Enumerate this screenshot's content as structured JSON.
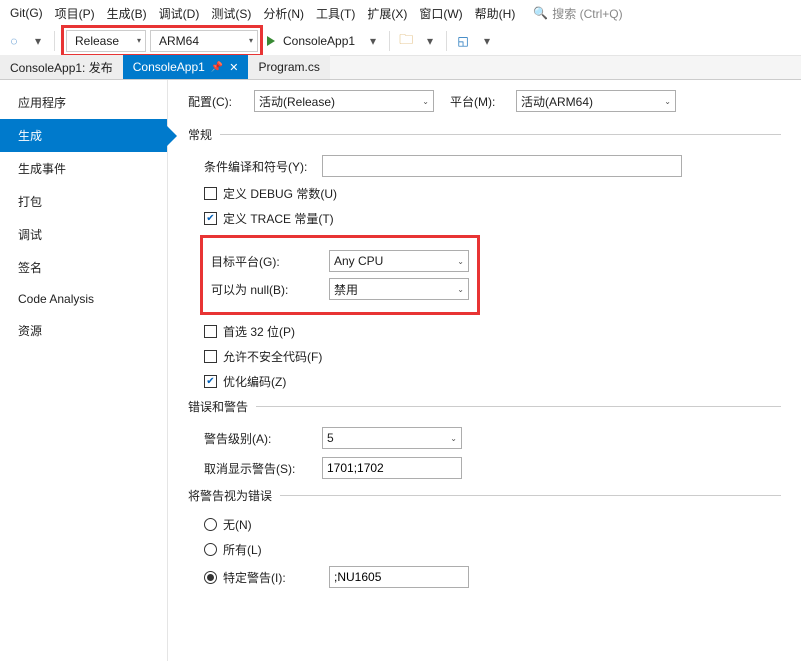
{
  "menubar": {
    "items": [
      "Git(G)",
      "项目(P)",
      "生成(B)",
      "调试(D)",
      "测试(S)",
      "分析(N)",
      "工具(T)",
      "扩展(X)",
      "窗口(W)",
      "帮助(H)"
    ],
    "search_placeholder": "搜索 (Ctrl+Q)"
  },
  "toolbar": {
    "config": "Release",
    "platform": "ARM64",
    "run_label": "ConsoleApp1"
  },
  "tabs": {
    "t0": "ConsoleApp1: 发布",
    "t1": "ConsoleApp1",
    "t2": "Program.cs"
  },
  "sidebar": {
    "items": [
      "应用程序",
      "生成",
      "生成事件",
      "打包",
      "调试",
      "签名",
      "Code Analysis",
      "资源"
    ]
  },
  "panel": {
    "config_label": "配置(C):",
    "config_value": "活动(Release)",
    "platform_label": "平台(M):",
    "platform_value": "活动(ARM64)",
    "section_general": "常规",
    "cond_sym_label": "条件编译和符号(Y):",
    "cond_sym_value": "",
    "debug_const": "定义 DEBUG 常数(U)",
    "trace_const": "定义 TRACE 常量(T)",
    "target_platform_label": "目标平台(G):",
    "target_platform_value": "Any CPU",
    "nullable_label": "可以为 null(B):",
    "nullable_value": "禁用",
    "prefer32_label": "首选 32 位(P)",
    "unsafe_label": "允许不安全代码(F)",
    "optimize_label": "优化编码(Z)",
    "section_errors": "错误和警告",
    "warn_level_label": "警告级别(A):",
    "warn_level_value": "5",
    "suppress_warn_label": "取消显示警告(S):",
    "suppress_warn_value": "1701;1702",
    "section_treat_as_errors": "将警告视为错误",
    "radio_none": "无(N)",
    "radio_all": "所有(L)",
    "radio_specific": "特定警告(I):",
    "specific_value": ";NU1605"
  }
}
